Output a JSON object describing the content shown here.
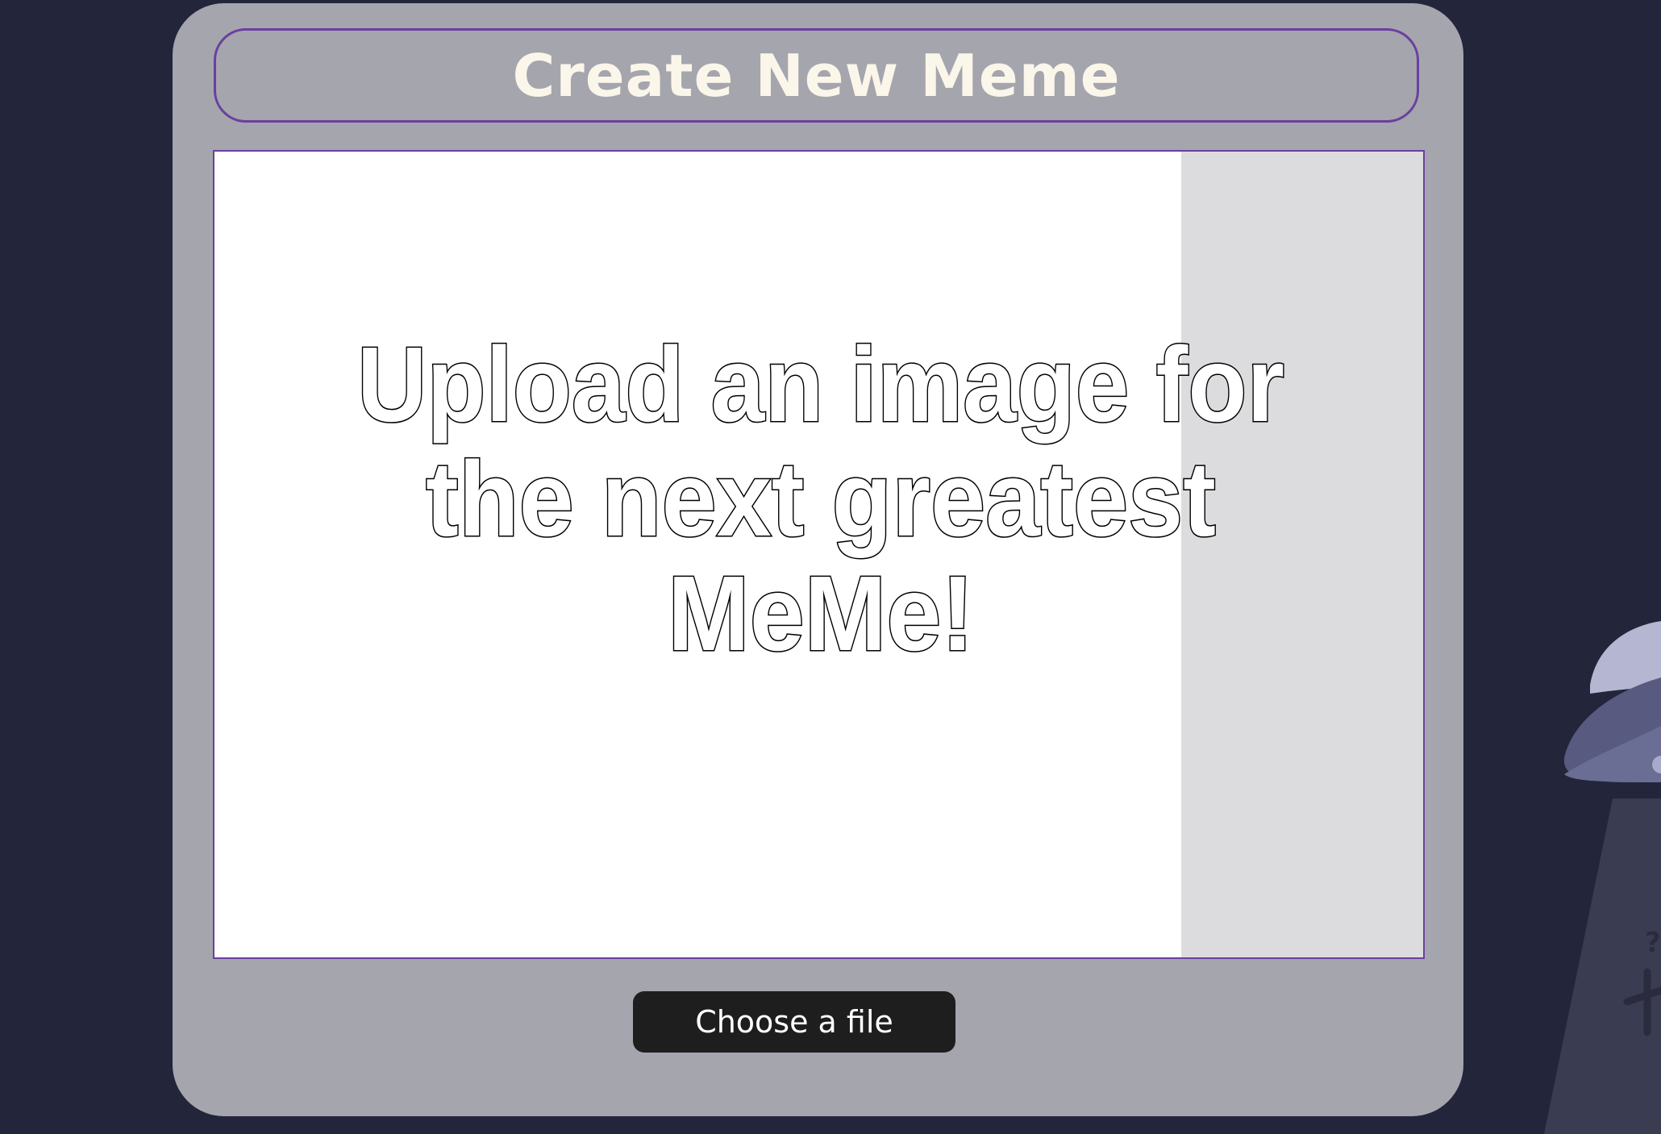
{
  "header": {
    "title": "Create New Meme"
  },
  "canvas": {
    "placeholder_lines": [
      "Upload an image for",
      "the next greatest",
      "MeMe!"
    ]
  },
  "upload": {
    "button_label": "Choose a file"
  },
  "decoration": {
    "ufo_mark": "?"
  },
  "colors": {
    "page_background": "#23253a",
    "panel_background": "#a5a5ad",
    "accent_border": "#6a3fa0",
    "title_text": "#fbf6ea",
    "button_background": "#1e1e1e"
  }
}
